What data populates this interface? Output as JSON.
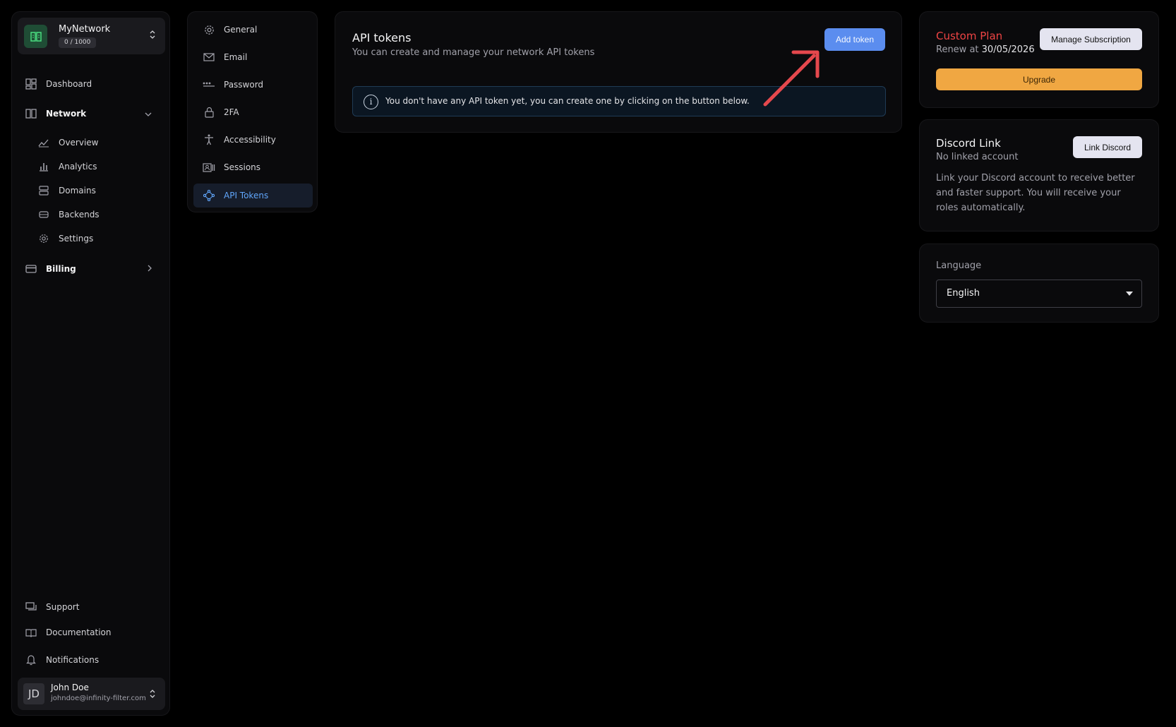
{
  "sidebar": {
    "network_name": "MyNetwork",
    "network_count": "0 / 1000",
    "items": {
      "dashboard": "Dashboard",
      "network": "Network",
      "overview": "Overview",
      "analytics": "Analytics",
      "domains": "Domains",
      "backends": "Backends",
      "settings": "Settings",
      "billing": "Billing",
      "support": "Support",
      "documentation": "Documentation",
      "notifications": "Notifications"
    },
    "user": {
      "initials": "JD",
      "name": "John Doe",
      "email": "johndoe@infinity-filter.com"
    }
  },
  "settings_menu": {
    "items": [
      "General",
      "Email",
      "Password",
      "2FA",
      "Accessibility",
      "Sessions",
      "API Tokens"
    ],
    "active": "API Tokens"
  },
  "api_tokens": {
    "title": "API tokens",
    "subtitle": "You can create and manage your network API tokens",
    "add_button": "Add token",
    "info_icon": "i",
    "empty_message": "You don't have any API token yet, you can create one by clicking on the button below."
  },
  "plan": {
    "name": "Custom Plan",
    "renew_label": "Renew at",
    "renew_date": "30/05/2026",
    "manage_button": "Manage Subscription",
    "upgrade_button": "Upgrade"
  },
  "discord": {
    "title": "Discord Link",
    "status": "No linked account",
    "link_button": "Link Discord",
    "description": "Link your Discord account to receive better and faster support. You will receive your roles automatically."
  },
  "language": {
    "label": "Language",
    "selected": "English"
  },
  "colors": {
    "accent": "#5b8def",
    "plan_red": "#ef4444",
    "upgrade_orange": "#f0a742",
    "annotation_arrow": "#e5484d"
  },
  "icons": {
    "network_logo": "network-grid-icon",
    "dashboard": "dashboard-grid-icon",
    "network": "network-panels-icon",
    "overview": "trend-icon",
    "analytics": "bar-chart-icon",
    "domains": "server-icon",
    "backends": "hard-drive-icon",
    "settings": "gear-icon",
    "billing": "credit-card-icon",
    "support": "chat-icon",
    "documentation": "book-icon",
    "notifications": "bell-icon",
    "general": "gear-icon",
    "email": "mail-icon",
    "password": "dots-icon",
    "2fa": "lock-icon",
    "accessibility": "accessibility-icon",
    "sessions": "id-card-icon",
    "api_tokens": "diamond-nodes-icon"
  }
}
